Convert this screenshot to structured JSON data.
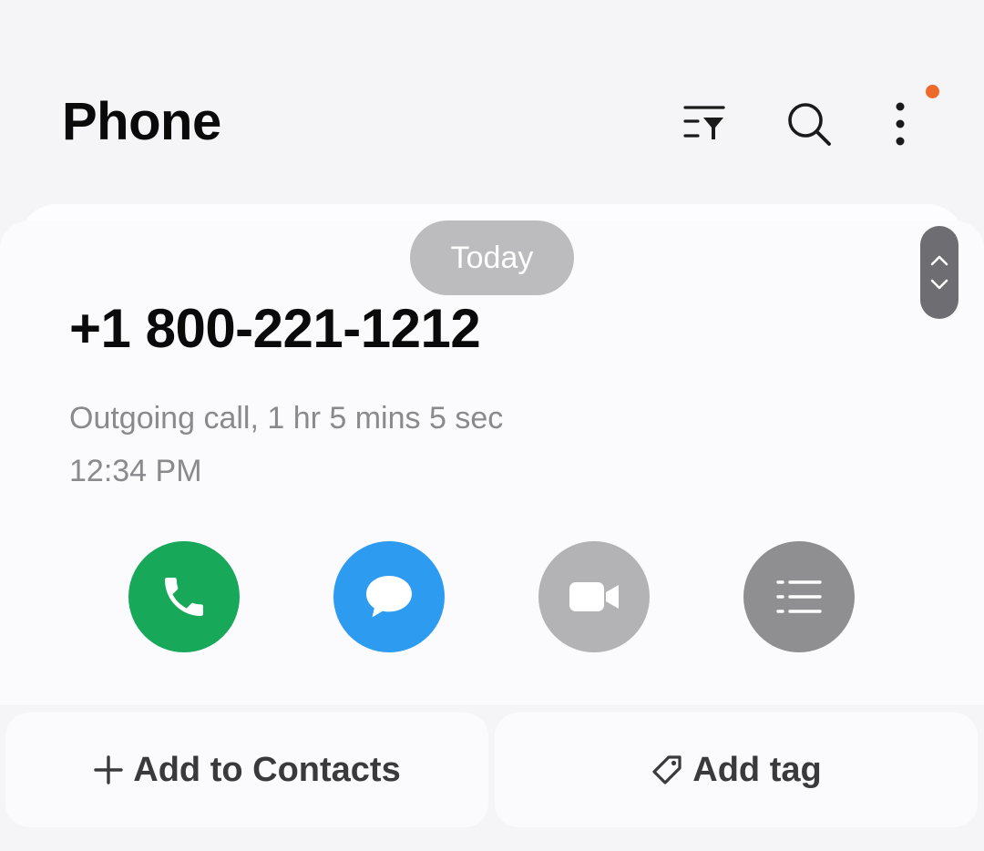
{
  "header": {
    "title": "Phone",
    "icons": [
      "filter-icon",
      "search-icon",
      "more-icon"
    ],
    "notification_color": "#ee6a2a"
  },
  "date_pill": "Today",
  "call": {
    "number": "+1 800-221-1212",
    "detail": "Outgoing call, 1 hr 5 mins 5 sec",
    "time": "12:34 PM"
  },
  "actions": [
    {
      "name": "call",
      "icon": "phone-icon",
      "color": "#17a85a"
    },
    {
      "name": "message",
      "icon": "message-icon",
      "color": "#2d9bf0"
    },
    {
      "name": "video",
      "icon": "video-icon",
      "color": "#b3b3b5"
    },
    {
      "name": "details",
      "icon": "list-icon",
      "color": "#8f8f91"
    }
  ],
  "bottom": {
    "add_contacts": "Add to Contacts",
    "add_tag": "Add tag"
  }
}
